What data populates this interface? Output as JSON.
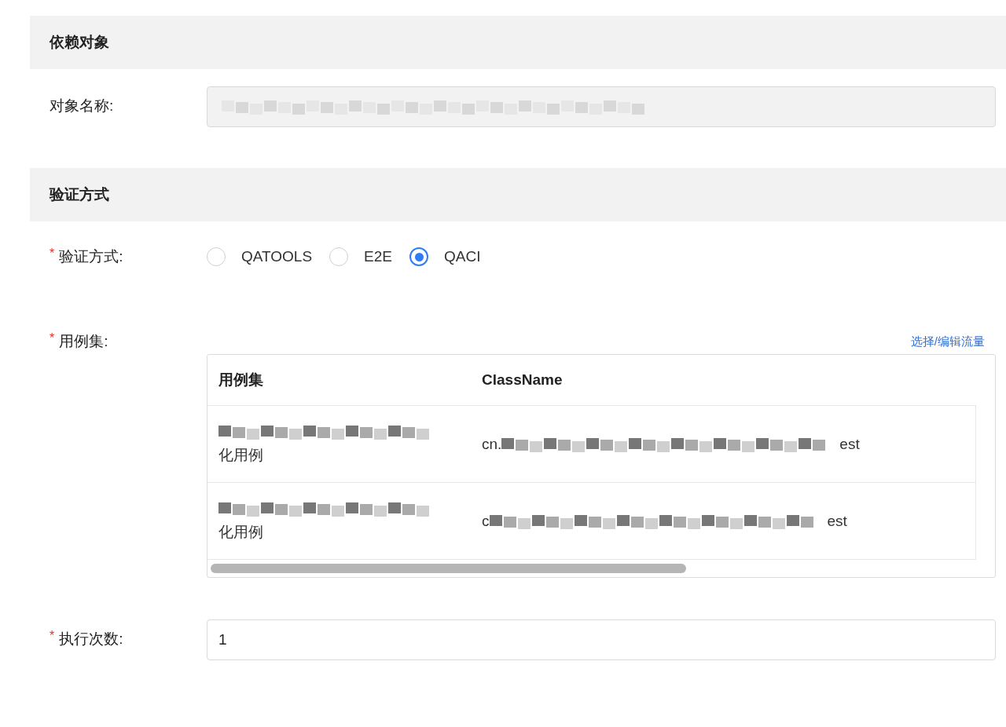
{
  "sections": [
    {
      "title": "依赖对象",
      "fields": [
        {
          "kind": "masked_text",
          "label": "对象名称:",
          "disabled": true
        }
      ]
    },
    {
      "title": "验证方式",
      "fields": [
        {
          "kind": "radio",
          "label": "验证方式:",
          "marker": "*",
          "options": [
            {
              "label": "QATOOLS",
              "selected": false
            },
            {
              "label": "E2E",
              "selected": false
            },
            {
              "label": "QACI",
              "selected": true
            }
          ]
        },
        {
          "kind": "table",
          "label": "用例集:",
          "marker": "*",
          "link": "选择/编辑流量",
          "columns": [
            "用例集",
            "ClassName"
          ],
          "rows": [
            {
              "cells": [
                {
                  "tail": "化用例"
                },
                {
                  "head": "cn.",
                  "tail": "est"
                }
              ]
            },
            {
              "cells": [
                {
                  "tail": "化用例"
                },
                {
                  "head": "c",
                  "tail": "est"
                }
              ]
            }
          ]
        },
        {
          "kind": "text",
          "label": "执行次数:",
          "marker": "*",
          "disabled": false,
          "value": "1"
        }
      ]
    }
  ]
}
